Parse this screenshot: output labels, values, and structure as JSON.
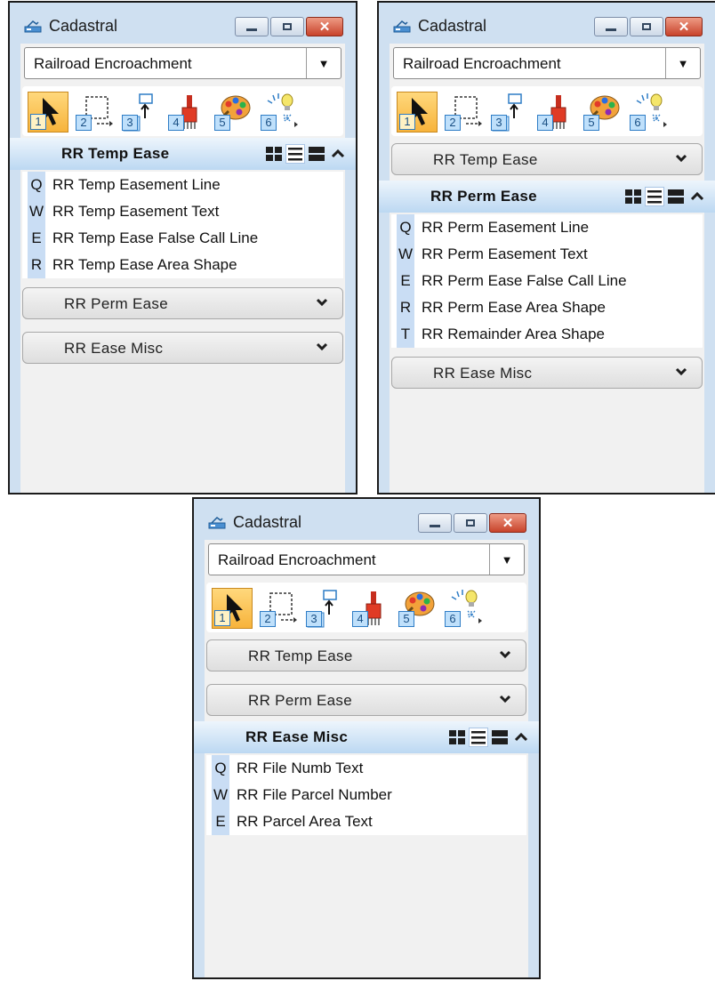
{
  "panels": [
    {
      "title": "Cadastral",
      "dropdown_value": "Railroad Encroachment",
      "tool_numbers": [
        "1",
        "2",
        "3",
        "4",
        "5",
        "6"
      ],
      "collapsed_before": [],
      "expanded_group": {
        "label": "RR Temp Ease",
        "items": [
          {
            "key": "Q",
            "label": "RR Temp Easement Line"
          },
          {
            "key": "W",
            "label": "RR Temp Easement Text"
          },
          {
            "key": "E",
            "label": "RR Temp Ease False Call Line"
          },
          {
            "key": "R",
            "label": "RR Temp Ease Area Shape"
          }
        ]
      },
      "collapsed_after": [
        "RR Perm Ease",
        "RR Ease Misc"
      ]
    },
    {
      "title": "Cadastral",
      "dropdown_value": "Railroad Encroachment",
      "tool_numbers": [
        "1",
        "2",
        "3",
        "4",
        "5",
        "6"
      ],
      "collapsed_before": [
        "RR Temp Ease"
      ],
      "expanded_group": {
        "label": "RR Perm Ease",
        "items": [
          {
            "key": "Q",
            "label": "RR Perm Easement Line"
          },
          {
            "key": "W",
            "label": "RR Perm Easement Text"
          },
          {
            "key": "E",
            "label": "RR Perm Ease False Call Line"
          },
          {
            "key": "R",
            "label": "RR Perm Ease Area Shape"
          },
          {
            "key": "T",
            "label": "RR Remainder Area Shape"
          }
        ]
      },
      "collapsed_after": [
        "RR Ease Misc"
      ]
    },
    {
      "title": "Cadastral",
      "dropdown_value": "Railroad Encroachment",
      "tool_numbers": [
        "1",
        "2",
        "3",
        "4",
        "5",
        "6"
      ],
      "collapsed_before": [
        "RR Temp Ease",
        "RR Perm Ease"
      ],
      "expanded_group": {
        "label": "RR Ease Misc",
        "items": [
          {
            "key": "Q",
            "label": "RR File Numb Text"
          },
          {
            "key": "W",
            "label": "RR File Parcel Number"
          },
          {
            "key": "E",
            "label": "RR Parcel Area Text"
          }
        ]
      },
      "collapsed_after": []
    }
  ],
  "icons": {
    "app": "cadastral-icon",
    "minimize": "minimize-icon",
    "maximize": "maximize-icon",
    "close": "close-icon",
    "dropdown": "dropdown-arrow-icon",
    "tools": [
      "select-arrow-icon",
      "dashed-rectangle-icon",
      "place-cell-icon",
      "fill-icon",
      "palette-icon",
      "lightbulb-icon"
    ],
    "view_modes": [
      "icon-grid-view-icon",
      "list-view-icon",
      "large-list-view-icon"
    ],
    "collapse": "chevron-up-icon",
    "expand": "chevron-down-icon"
  },
  "colors": {
    "frame": "#cfe0f1",
    "selected_tool": "#f7b33b",
    "key_column": "#c9ddf4",
    "close_button": "#c8432b",
    "expanded_header": "#bcd8f2"
  }
}
